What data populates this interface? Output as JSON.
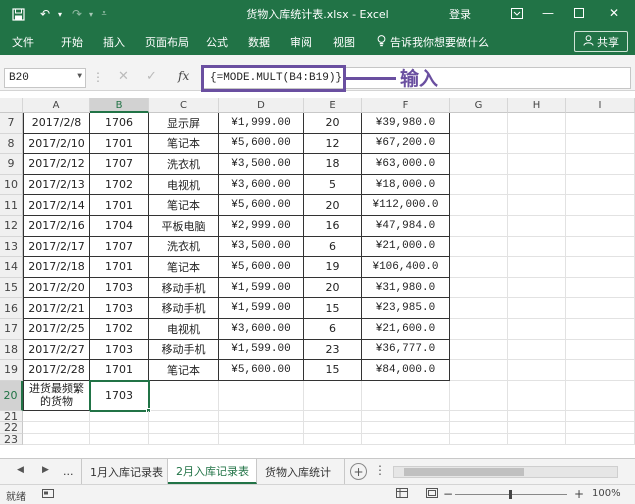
{
  "titlebar": {
    "doc_title": "货物入库统计表.xlsx  -  Excel",
    "login": "登录",
    "save_icon": "save-icon",
    "undo_icon": "undo-icon",
    "redo_icon": "redo-icon"
  },
  "ribbon": {
    "tabs": [
      "文件",
      "开始",
      "插入",
      "页面布局",
      "公式",
      "数据",
      "审阅",
      "视图"
    ],
    "tell_me": "告诉我你想要做什么",
    "share": "共享"
  },
  "formula_bar": {
    "name_box": "B20",
    "formula": "{=MODE.MULT(B4:B19)}"
  },
  "annotation": {
    "label": "输入",
    "color": "#6a4fa0"
  },
  "columns": [
    "A",
    "B",
    "C",
    "D",
    "E",
    "F",
    "G",
    "H",
    "I"
  ],
  "rows": [
    {
      "num": "7",
      "date": "2017/2/8",
      "code": "1706",
      "name": "显示屏",
      "price": "¥1,999.00",
      "qty": "20",
      "amount": "¥39,980.0"
    },
    {
      "num": "8",
      "date": "2017/2/10",
      "code": "1701",
      "name": "笔记本",
      "price": "¥5,600.00",
      "qty": "12",
      "amount": "¥67,200.0"
    },
    {
      "num": "9",
      "date": "2017/2/12",
      "code": "1707",
      "name": "洗衣机",
      "price": "¥3,500.00",
      "qty": "18",
      "amount": "¥63,000.0"
    },
    {
      "num": "10",
      "date": "2017/2/13",
      "code": "1702",
      "name": "电视机",
      "price": "¥3,600.00",
      "qty": "5",
      "amount": "¥18,000.0"
    },
    {
      "num": "11",
      "date": "2017/2/14",
      "code": "1701",
      "name": "笔记本",
      "price": "¥5,600.00",
      "qty": "20",
      "amount": "¥112,000.0"
    },
    {
      "num": "12",
      "date": "2017/2/16",
      "code": "1704",
      "name": "平板电脑",
      "price": "¥2,999.00",
      "qty": "16",
      "amount": "¥47,984.0"
    },
    {
      "num": "13",
      "date": "2017/2/17",
      "code": "1707",
      "name": "洗衣机",
      "price": "¥3,500.00",
      "qty": "6",
      "amount": "¥21,000.0"
    },
    {
      "num": "14",
      "date": "2017/2/18",
      "code": "1701",
      "name": "笔记本",
      "price": "¥5,600.00",
      "qty": "19",
      "amount": "¥106,400.0"
    },
    {
      "num": "15",
      "date": "2017/2/20",
      "code": "1703",
      "name": "移动手机",
      "price": "¥1,599.00",
      "qty": "20",
      "amount": "¥31,980.0"
    },
    {
      "num": "16",
      "date": "2017/2/21",
      "code": "1703",
      "name": "移动手机",
      "price": "¥1,599.00",
      "qty": "15",
      "amount": "¥23,985.0"
    },
    {
      "num": "17",
      "date": "2017/2/25",
      "code": "1702",
      "name": "电视机",
      "price": "¥3,600.00",
      "qty": "6",
      "amount": "¥21,600.0"
    },
    {
      "num": "18",
      "date": "2017/2/27",
      "code": "1703",
      "name": "移动手机",
      "price": "¥1,599.00",
      "qty": "23",
      "amount": "¥36,777.0"
    },
    {
      "num": "19",
      "date": "2017/2/28",
      "code": "1701",
      "name": "笔记本",
      "price": "¥5,600.00",
      "qty": "15",
      "amount": "¥84,000.0"
    }
  ],
  "result_row": {
    "num": "20",
    "label": "进货最频繁的货物",
    "value": "1703"
  },
  "empty_rows": [
    "21",
    "22",
    "23"
  ],
  "sheet_tabs": {
    "ellipsis": "...",
    "tabs": [
      "1月入库记录表",
      "2月入库记录表",
      "货物入库统计"
    ],
    "active_index": 1
  },
  "status": {
    "ready": "就绪",
    "zoom": "100%"
  },
  "colors": {
    "excel_green": "#217346"
  }
}
